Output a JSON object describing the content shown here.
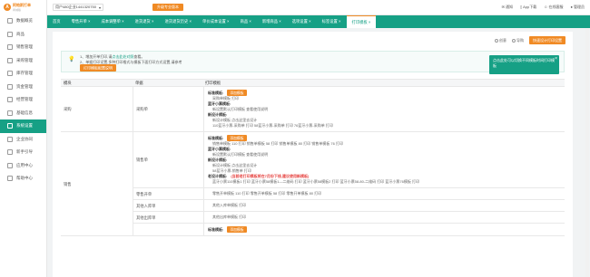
{
  "app": {
    "logo_mark": "A",
    "logo_name": "阿帕斯打单",
    "logo_sub": "商城版"
  },
  "sidebar": {
    "items": [
      {
        "label": "数据概览",
        "icon": "dashboard-icon",
        "active": false
      },
      {
        "label": "商品",
        "icon": "goods-icon",
        "active": false
      },
      {
        "label": "销售管理",
        "icon": "sales-icon",
        "active": false
      },
      {
        "label": "采购管理",
        "icon": "purchase-icon",
        "active": false
      },
      {
        "label": "库存管理",
        "icon": "stock-icon",
        "active": false
      },
      {
        "label": "资金管理",
        "icon": "money-icon",
        "active": false
      },
      {
        "label": "经营管理",
        "icon": "chart-icon",
        "active": false
      },
      {
        "label": "基础信息",
        "icon": "info-icon",
        "active": false
      },
      {
        "label": "系统设置",
        "icon": "settings-icon",
        "active": true
      },
      {
        "label": "企业协同",
        "icon": "team-icon",
        "active": false
      },
      {
        "label": "新手引导",
        "icon": "guide-icon",
        "active": false
      },
      {
        "label": "应用中心",
        "icon": "apps-icon",
        "active": false
      },
      {
        "label": "帮助中心",
        "icon": "help-icon",
        "active": false
      }
    ]
  },
  "topbar": {
    "shop": "用户480企业1441320750",
    "action_btn": "升级专业版本",
    "notice": "通知",
    "app_label": "App下载",
    "online": "在线客服",
    "user": "管理员"
  },
  "tabs": [
    {
      "label": "首页",
      "active": false
    },
    {
      "label": "零售开单 ×",
      "active": false
    },
    {
      "label": "成本调整单 ×",
      "active": false
    },
    {
      "label": "进货退货 ×",
      "active": false
    },
    {
      "label": "进货退货历史 ×",
      "active": false
    },
    {
      "label": "单价成本设置 ×",
      "active": false
    },
    {
      "label": "商品 ×",
      "active": false
    },
    {
      "label": "新增商品 ×",
      "active": false
    },
    {
      "label": "选项设置 ×",
      "active": false
    },
    {
      "label": "标签设置 ×",
      "active": false
    },
    {
      "label": "打印模板 ×",
      "active": true
    }
  ],
  "tools": {
    "radio1": "创意",
    "radio2": "导购",
    "button": "快速设计打印设置"
  },
  "notice": {
    "line1_pre": "1、增加开单打印,请",
    "line1_link": "点击此处对照",
    "line1_post": "查看。",
    "line2": "2、单据打印设置,多种打印格式与模板下面打印方式设置,请参考",
    "button": "打印模板配置说明"
  },
  "tip": {
    "text": "点击此处可以切换不同模板时间打印模板",
    "close": "×"
  },
  "table": {
    "headers": [
      "模块",
      "单据",
      "打印模板"
    ],
    "groups": [
      {
        "module": "采购",
        "rows": [
          {
            "doc": "采购单",
            "blocks": [
              {
                "title": "标准模板:",
                "btn": "添加模板",
                "lines": [
                  "采购单模板 打印"
                ]
              },
              {
                "title": "蓝牙小票模板:",
                "lines": [
                  "新设置默认打印模板 查看使用说明"
                ]
              },
              {
                "title": "新设计模板:",
                "lines": [
                  "新设计模板 点击这里去设计",
                  "110蓝牙小票-采购单 打印    58蓝牙小票-采购单 打印    76蓝牙小票-采购单 打印"
                ]
              }
            ]
          }
        ]
      },
      {
        "module": "销售",
        "rows": [
          {
            "doc": "销售单",
            "blocks": [
              {
                "title": "标准模板:",
                "btn": "添加模板",
                "lines": [
                  "销售单模板 110 打印    销售单模板 58 打印    销售单模板 80 打印    销售单模板 76 打印"
                ]
              },
              {
                "title": "蓝牙小票模板:",
                "lines": [
                  "新设置默认打印模板 查看使用说明"
                ]
              },
              {
                "title": "新设计模板:",
                "lines": [
                  "新设计模板 点击这里去设计",
                  "58蓝牙小票-销售单 打印"
                ]
              },
              {
                "title": "老设计模板:",
                "red": "(当前老打印模板将在7月份下线,建议使用新模板)",
                "lines": [
                  "蓝牙小票110模板1 打印    蓝牙小票58模板1—二维码 打印    蓝牙小票58模板2 打印    蓝牙小票58-80-二维码 打印    蓝牙小票76模板 打印"
                ]
              }
            ]
          },
          {
            "doc": "零售开单",
            "blocks": [
              {
                "title": "",
                "lines": [
                  "零售开单模板 110 打印    零售开单模板 58 打印    零售开单模板 80 打印"
                ]
              }
            ]
          },
          {
            "doc": "其他入库单",
            "blocks": [
              {
                "title": "",
                "lines": [
                  "其他入库单模板 打印"
                ]
              }
            ]
          },
          {
            "doc": "其他出库单",
            "blocks": [
              {
                "title": "",
                "lines": [
                  "其他出库单模板 打印"
                ]
              }
            ]
          },
          {
            "doc": "",
            "blocks": [
              {
                "title": "标准模板:",
                "btn": "添加模板",
                "lines": []
              }
            ]
          }
        ]
      }
    ]
  },
  "colors": {
    "accent": "#16a085",
    "orange": "#f08a24"
  }
}
